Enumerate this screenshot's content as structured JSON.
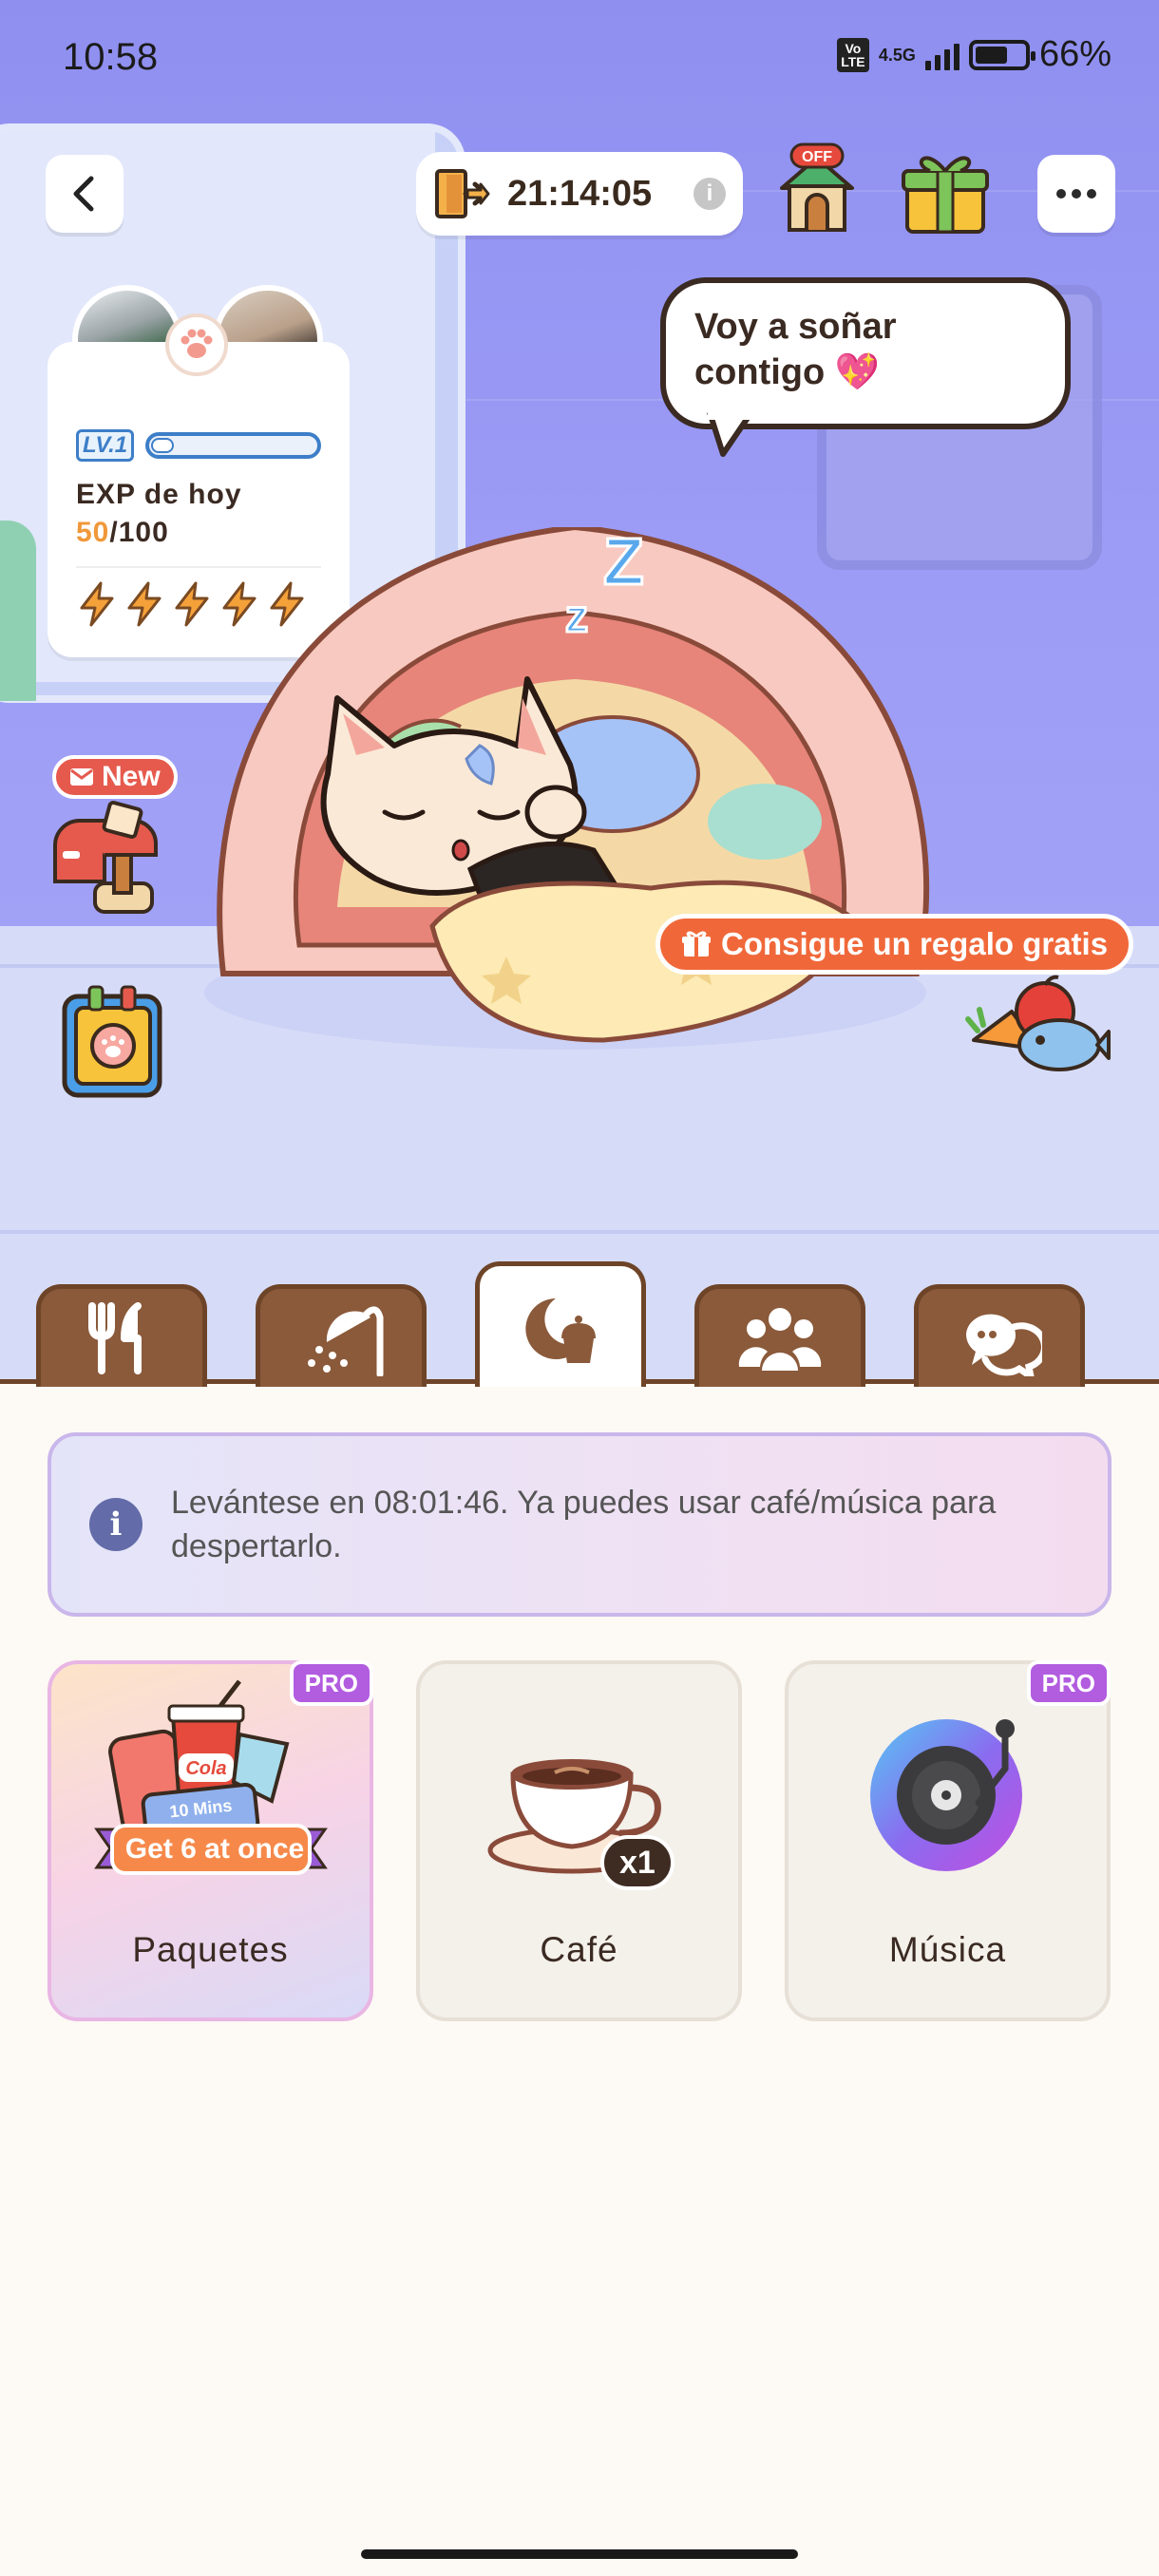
{
  "status_bar": {
    "time": "10:58",
    "volte": "Vo LTE",
    "network": "4.5G",
    "battery": "66%",
    "battery_level": 0.66
  },
  "header": {
    "timer": "21:14:05"
  },
  "speech_bubble": {
    "text": "Voy a soñar contigo 💖"
  },
  "exp_card": {
    "level": "LV.1",
    "label": "EXP de hoy",
    "current": "50",
    "total": "/100",
    "energy_count": 5
  },
  "mailbox": {
    "badge": "New"
  },
  "free_gift": {
    "label": "Consigue un regalo gratis"
  },
  "tabs": [
    {
      "name": "feed",
      "icon": "fork-knife-icon",
      "active": false
    },
    {
      "name": "bath",
      "icon": "shower-icon",
      "active": false
    },
    {
      "name": "sleep",
      "icon": "moon-cupcake-icon",
      "active": true
    },
    {
      "name": "friends",
      "icon": "people-icon",
      "active": false
    },
    {
      "name": "chat",
      "icon": "chat-bubbles-icon",
      "active": false
    }
  ],
  "info_box": {
    "text": "Levántese en 08:01:46. Ya puedes usar café/música para despertarlo."
  },
  "items": {
    "pack": {
      "label": "Paquetes",
      "badge": "PRO",
      "banner": "Get 6 at once",
      "drink_label": "Cola",
      "ticket": "10 Mins"
    },
    "coffee": {
      "label": "Café",
      "qty": "x1"
    },
    "music": {
      "label": "Música",
      "badge": "PRO"
    }
  },
  "colors": {
    "scene_bg": "#9c9cf6",
    "tab_brown": "#8b5a3a",
    "accent_orange": "#f0683a",
    "pro_purple": "#b25ce0",
    "new_red": "#e65a4e"
  }
}
